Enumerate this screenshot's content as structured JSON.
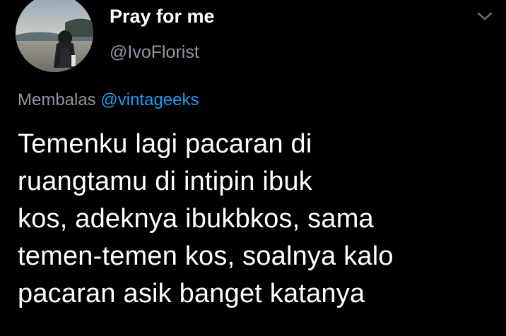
{
  "author": {
    "display_name": "Pray for me",
    "handle": "@IvoFlorist",
    "avatar_icon": "profile-photo-beach"
  },
  "menu": {
    "icon": "chevron-down-icon"
  },
  "reply": {
    "prefix": "Membalas",
    "mention": "@vintageeks"
  },
  "tweet": {
    "lines": [
      "Temenku lagi pacaran di",
      "ruangtamu di intipin ibuk",
      "kos, adeknya ibukbkos, sama",
      "temen-temen kos, soalnya kalo",
      "pacaran asik banget katanya"
    ]
  },
  "colors": {
    "background": "#000000",
    "text": "#ffffff",
    "secondary_text": "#8b98a5",
    "accent": "#1d9bf0"
  }
}
